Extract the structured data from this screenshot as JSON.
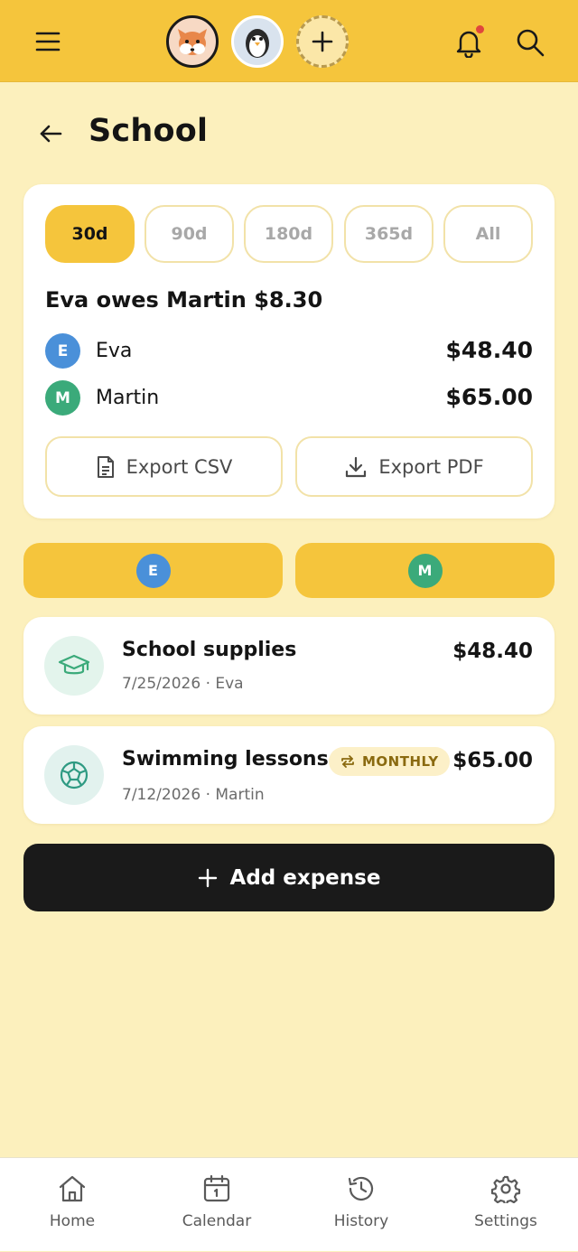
{
  "header": {
    "menu_icon": "hamburger-menu-icon",
    "avatars": [
      {
        "name": "fox-avatar",
        "bg": "#F7D9C4"
      },
      {
        "name": "penguin-avatar",
        "bg": "#D9E3EE"
      }
    ],
    "add_profile_icon": "plus-icon",
    "notification_icon": "bell-icon",
    "search_icon": "search-icon"
  },
  "page": {
    "title": "School"
  },
  "summary": {
    "ranges": [
      "30d",
      "90d",
      "180d",
      "365d",
      "All"
    ],
    "selected_range": "30d",
    "balance_text": "Eva owes Martin $8.30",
    "people": [
      {
        "initial": "E",
        "name": "Eva",
        "amount": "$48.40",
        "color": "#4A90D9"
      },
      {
        "initial": "M",
        "name": "Martin",
        "amount": "$65.00",
        "color": "#3BAA7A"
      }
    ],
    "export_csv_label": "Export CSV",
    "export_pdf_label": "Export PDF"
  },
  "filters": [
    {
      "initial": "E",
      "color": "#4A90D9"
    },
    {
      "initial": "M",
      "color": "#3BAA7A"
    }
  ],
  "expenses": [
    {
      "title": "School supplies",
      "meta": "7/25/2026 · Eva",
      "amount": "$48.40",
      "icon": "graduation-cap-icon"
    },
    {
      "title": "Swimming lessons",
      "meta": "7/12/2026 · Martin",
      "amount": "$65.00",
      "icon": "soccer-ball-icon",
      "badge": "MONTHLY"
    }
  ],
  "add_expense_label": "Add expense",
  "nav": [
    {
      "label": "Home",
      "icon": "home-icon"
    },
    {
      "label": "Calendar",
      "icon": "calendar-icon"
    },
    {
      "label": "History",
      "icon": "history-icon"
    },
    {
      "label": "Settings",
      "icon": "gear-icon"
    }
  ],
  "colors": {
    "accent": "#F5C53C",
    "background": "#FCF0BD",
    "notification_dot": "#E0463C"
  }
}
